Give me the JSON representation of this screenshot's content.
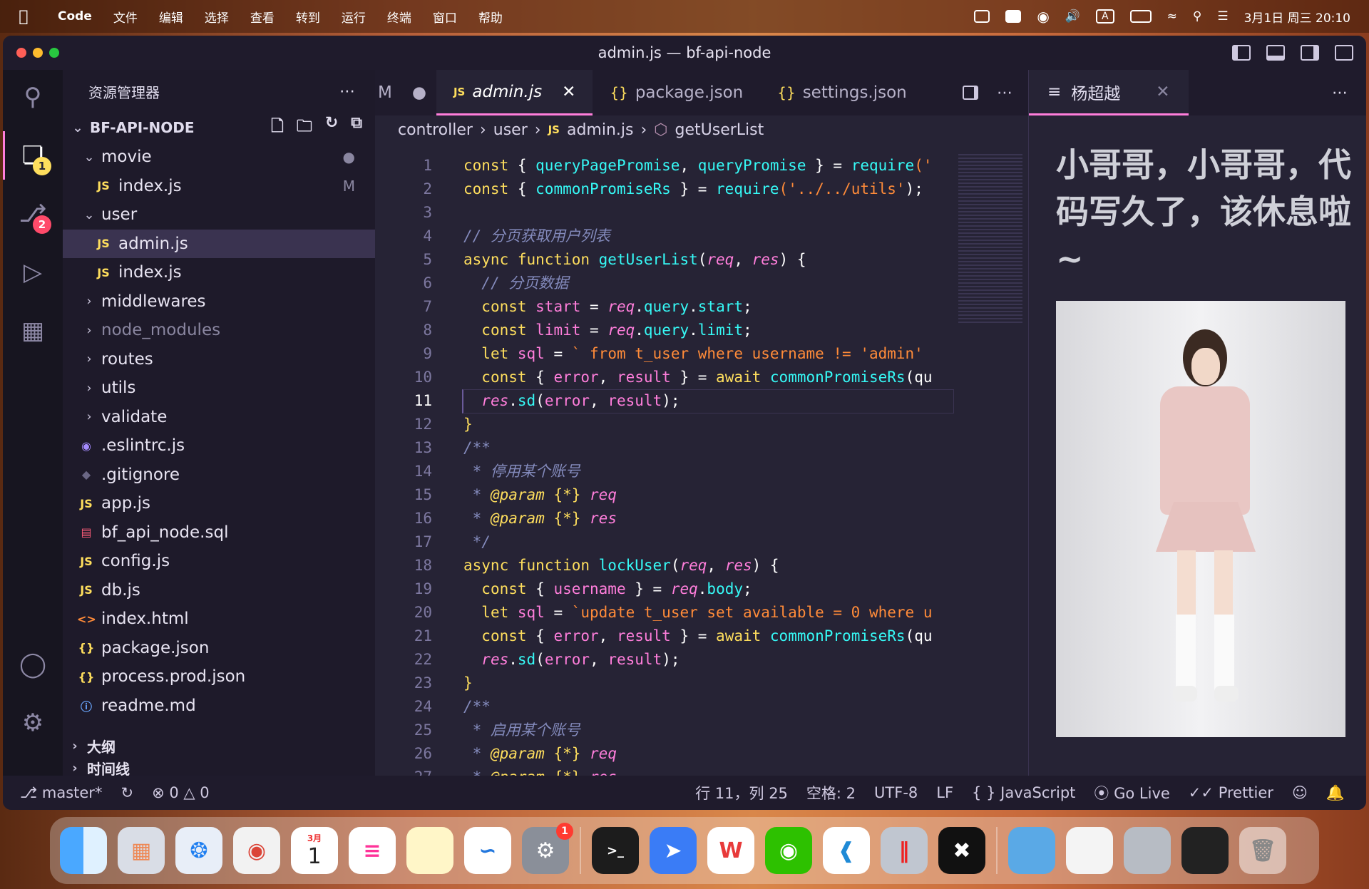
{
  "menubar": {
    "app_name": "Code",
    "items": [
      "文件",
      "编辑",
      "选择",
      "查看",
      "转到",
      "运行",
      "终端",
      "窗口",
      "帮助"
    ],
    "input_indicator": "A",
    "datetime": "3月1日 周三 20:10"
  },
  "window": {
    "title": "admin.js — bf-api-node"
  },
  "activity": {
    "explorer_badge": "1",
    "scm_badge": "2"
  },
  "sidebar": {
    "title": "资源管理器",
    "project": "BF-API-NODE",
    "tree": [
      {
        "label": "movie",
        "type": "folder-open",
        "indent": 1,
        "mark": "●"
      },
      {
        "label": "index.js",
        "type": "js",
        "indent": 2,
        "mark": "M"
      },
      {
        "label": "user",
        "type": "folder-open",
        "indent": 1,
        "mark": ""
      },
      {
        "label": "admin.js",
        "type": "js",
        "indent": 2,
        "mark": "",
        "selected": true
      },
      {
        "label": "index.js",
        "type": "js",
        "indent": 2,
        "mark": ""
      },
      {
        "label": "middlewares",
        "type": "folder",
        "indent": 1,
        "mark": ""
      },
      {
        "label": "node_modules",
        "type": "folder",
        "indent": 1,
        "mark": "",
        "dim": true
      },
      {
        "label": "routes",
        "type": "folder",
        "indent": 1,
        "mark": ""
      },
      {
        "label": "utils",
        "type": "folder",
        "indent": 1,
        "mark": ""
      },
      {
        "label": "validate",
        "type": "folder",
        "indent": 1,
        "mark": ""
      },
      {
        "label": ".eslintrc.js",
        "type": "eslint",
        "indent": 0,
        "mark": ""
      },
      {
        "label": ".gitignore",
        "type": "git",
        "indent": 0,
        "mark": ""
      },
      {
        "label": "app.js",
        "type": "js",
        "indent": 0,
        "mark": ""
      },
      {
        "label": "bf_api_node.sql",
        "type": "db",
        "indent": 0,
        "mark": ""
      },
      {
        "label": "config.js",
        "type": "js",
        "indent": 0,
        "mark": ""
      },
      {
        "label": "db.js",
        "type": "js",
        "indent": 0,
        "mark": ""
      },
      {
        "label": "index.html",
        "type": "html",
        "indent": 0,
        "mark": ""
      },
      {
        "label": "package.json",
        "type": "json",
        "indent": 0,
        "mark": ""
      },
      {
        "label": "process.prod.json",
        "type": "json",
        "indent": 0,
        "mark": ""
      },
      {
        "label": "readme.md",
        "type": "info",
        "indent": 0,
        "mark": ""
      }
    ],
    "outline": "大纲",
    "timeline": "时间线"
  },
  "tabs": [
    {
      "label": "M",
      "kind": "partial"
    },
    {
      "label": "admin.js",
      "kind": "js",
      "active": true
    },
    {
      "label": "package.json",
      "kind": "json"
    },
    {
      "label": "settings.json",
      "kind": "json"
    }
  ],
  "breadcrumb": [
    "controller",
    "user",
    "admin.js",
    "getUserList"
  ],
  "code": {
    "current_line": 11,
    "lines": [
      [
        [
          "k",
          "const "
        ],
        [
          "pr",
          "{ "
        ],
        [
          "f",
          "queryPagePromise"
        ],
        [
          "pr",
          ", "
        ],
        [
          "f",
          "queryPromise"
        ],
        [
          "pr",
          " } = "
        ],
        [
          "f",
          "require"
        ],
        [
          "s",
          "('"
        ]
      ],
      [
        [
          "k",
          "const "
        ],
        [
          "pr",
          "{ "
        ],
        [
          "f",
          "commonPromiseRs"
        ],
        [
          "pr",
          " } = "
        ],
        [
          "f",
          "require"
        ],
        [
          "s",
          "('../../utils'"
        ],
        [
          "pr",
          ");"
        ]
      ],
      [],
      [
        [
          "c",
          "// 分页获取用户列表"
        ]
      ],
      [
        [
          "k",
          "async function "
        ],
        [
          "f",
          "getUserList"
        ],
        [
          "pr",
          "("
        ],
        [
          "p",
          "req"
        ],
        [
          "pr",
          ", "
        ],
        [
          "p",
          "res"
        ],
        [
          "pr",
          ") {"
        ]
      ],
      [
        [
          "pr",
          "  "
        ],
        [
          "c",
          "// 分页数据"
        ]
      ],
      [
        [
          "pr",
          "  "
        ],
        [
          "k",
          "const "
        ],
        [
          "v",
          "start"
        ],
        [
          "pr",
          " = "
        ],
        [
          "p",
          "req"
        ],
        [
          "pr",
          "."
        ],
        [
          "f",
          "query"
        ],
        [
          "pr",
          "."
        ],
        [
          "f",
          "start"
        ],
        [
          "pr",
          ";"
        ]
      ],
      [
        [
          "pr",
          "  "
        ],
        [
          "k",
          "const "
        ],
        [
          "v",
          "limit"
        ],
        [
          "pr",
          " = "
        ],
        [
          "p",
          "req"
        ],
        [
          "pr",
          "."
        ],
        [
          "f",
          "query"
        ],
        [
          "pr",
          "."
        ],
        [
          "f",
          "limit"
        ],
        [
          "pr",
          ";"
        ]
      ],
      [
        [
          "pr",
          "  "
        ],
        [
          "k",
          "let "
        ],
        [
          "v",
          "sql"
        ],
        [
          "pr",
          " = "
        ],
        [
          "s",
          "` from t_user where username != 'admin'"
        ]
      ],
      [
        [
          "pr",
          "  "
        ],
        [
          "k",
          "const "
        ],
        [
          "pr",
          "{ "
        ],
        [
          "v",
          "error"
        ],
        [
          "pr",
          ", "
        ],
        [
          "v",
          "result"
        ],
        [
          "pr",
          " } = "
        ],
        [
          "k",
          "await "
        ],
        [
          "f",
          "commonPromiseRs"
        ],
        [
          "pr",
          "(qu"
        ]
      ],
      [
        [
          "pr",
          "  "
        ],
        [
          "p",
          "res"
        ],
        [
          "pr",
          "."
        ],
        [
          "f",
          "sd"
        ],
        [
          "pr",
          "("
        ],
        [
          "v",
          "error"
        ],
        [
          "pr",
          ", "
        ],
        [
          "v",
          "result"
        ],
        [
          "pr",
          ");"
        ]
      ],
      [
        [
          "k",
          "}"
        ]
      ],
      [
        [
          "c",
          "/**"
        ]
      ],
      [
        [
          "c",
          " * 停用某个账号"
        ]
      ],
      [
        [
          "c",
          " * "
        ],
        [
          "t",
          "@param "
        ],
        [
          "k",
          "{*} "
        ],
        [
          "p",
          "req"
        ]
      ],
      [
        [
          "c",
          " * "
        ],
        [
          "t",
          "@param "
        ],
        [
          "k",
          "{*} "
        ],
        [
          "p",
          "res"
        ]
      ],
      [
        [
          "c",
          " */"
        ]
      ],
      [
        [
          "k",
          "async function "
        ],
        [
          "f",
          "lockUser"
        ],
        [
          "pr",
          "("
        ],
        [
          "p",
          "req"
        ],
        [
          "pr",
          ", "
        ],
        [
          "p",
          "res"
        ],
        [
          "pr",
          ") {"
        ]
      ],
      [
        [
          "pr",
          "  "
        ],
        [
          "k",
          "const "
        ],
        [
          "pr",
          "{ "
        ],
        [
          "v",
          "username"
        ],
        [
          "pr",
          " } = "
        ],
        [
          "p",
          "req"
        ],
        [
          "pr",
          "."
        ],
        [
          "f",
          "body"
        ],
        [
          "pr",
          ";"
        ]
      ],
      [
        [
          "pr",
          "  "
        ],
        [
          "k",
          "let "
        ],
        [
          "v",
          "sql"
        ],
        [
          "pr",
          " = "
        ],
        [
          "s",
          "`update t_user set available = 0 where u"
        ]
      ],
      [
        [
          "pr",
          "  "
        ],
        [
          "k",
          "const "
        ],
        [
          "pr",
          "{ "
        ],
        [
          "v",
          "error"
        ],
        [
          "pr",
          ", "
        ],
        [
          "v",
          "result"
        ],
        [
          "pr",
          " } = "
        ],
        [
          "k",
          "await "
        ],
        [
          "f",
          "commonPromiseRs"
        ],
        [
          "pr",
          "(qu"
        ]
      ],
      [
        [
          "pr",
          "  "
        ],
        [
          "p",
          "res"
        ],
        [
          "pr",
          "."
        ],
        [
          "f",
          "sd"
        ],
        [
          "pr",
          "("
        ],
        [
          "v",
          "error"
        ],
        [
          "pr",
          ", "
        ],
        [
          "v",
          "result"
        ],
        [
          "pr",
          ");"
        ]
      ],
      [
        [
          "k",
          "}"
        ]
      ],
      [
        [
          "c",
          "/**"
        ]
      ],
      [
        [
          "c",
          " * 启用某个账号"
        ]
      ],
      [
        [
          "c",
          " * "
        ],
        [
          "t",
          "@param "
        ],
        [
          "k",
          "{*} "
        ],
        [
          "p",
          "req"
        ]
      ],
      [
        [
          "c",
          " * "
        ],
        [
          "t",
          "@param "
        ],
        [
          "k",
          "{*} "
        ],
        [
          "p",
          "res"
        ]
      ]
    ]
  },
  "panel": {
    "tab_label": "杨超越",
    "quote": "小哥哥，小哥哥，代码写久了，该休息啦~"
  },
  "status": {
    "branch": "master*",
    "errors": "0",
    "warnings": "0",
    "position": "行 11，列 25",
    "spaces": "空格: 2",
    "encoding": "UTF-8",
    "eol": "LF",
    "language": "JavaScript",
    "golive": "Go Live",
    "prettier": "Prettier"
  },
  "dock": {
    "calendar_month": "3月",
    "calendar_day": "1",
    "settings_badge": "1",
    "apps": [
      "Finder",
      "Launchpad",
      "Safari",
      "Chrome",
      "Calendar",
      "Reminders",
      "Notes",
      "Freeform",
      "System Settings",
      "Terminal",
      "DingTalk",
      "WPS Office",
      "WeChat",
      "VS Code",
      "Parallels",
      "CapCut",
      "Downloads",
      "Window 1",
      "Window 2",
      "Window 3",
      "Trash"
    ]
  },
  "colors": {
    "accent": "#ff7edb",
    "editor_bg": "#262335",
    "keyword": "#fede5d",
    "function": "#36f9f6",
    "string": "#ff8b39",
    "comment": "#848bbd"
  }
}
